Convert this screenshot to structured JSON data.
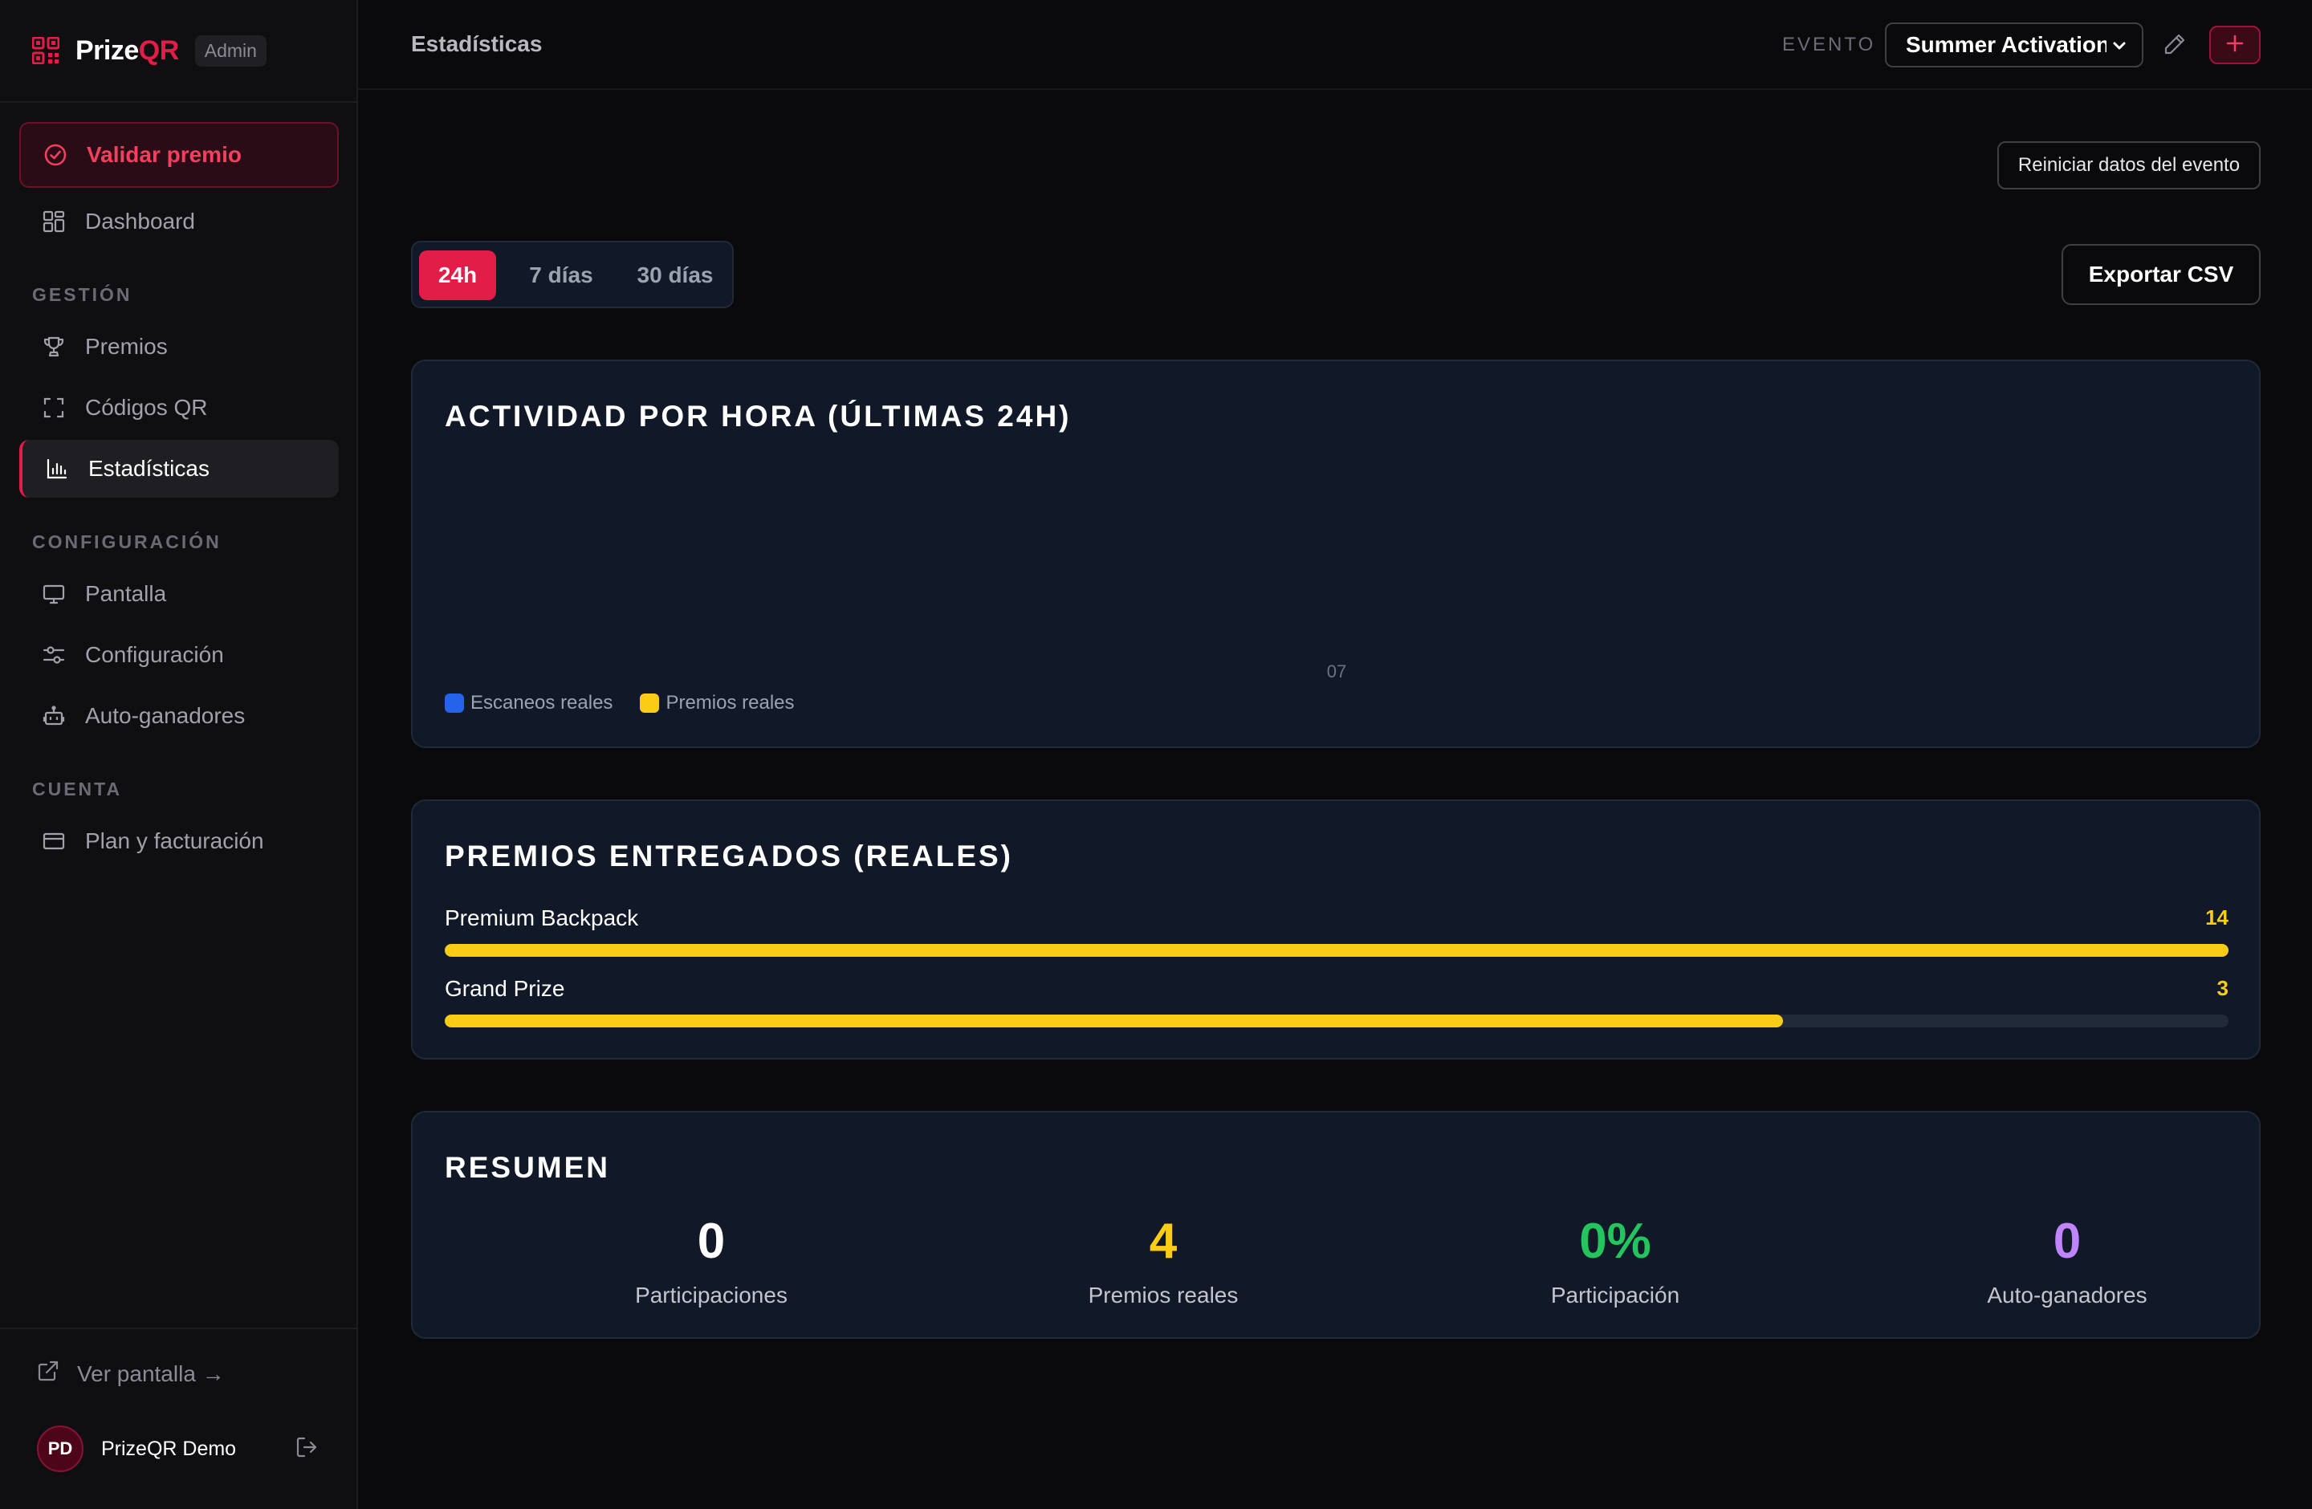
{
  "brand": {
    "name_part1": "Prize",
    "name_part2": "QR",
    "badge": "Admin"
  },
  "sidebar": {
    "primary_action": {
      "label": "Validar premio",
      "icon": "check-circle-icon"
    },
    "dashboard": {
      "label": "Dashboard",
      "icon": "grid-icon"
    },
    "sections": [
      {
        "label": "GESTIÓN",
        "items": [
          {
            "label": "Premios",
            "icon": "trophy-icon"
          },
          {
            "label": "Códigos QR",
            "icon": "scan-icon"
          },
          {
            "label": "Estadísticas",
            "icon": "bar-chart-icon",
            "active": true
          }
        ]
      },
      {
        "label": "CONFIGURACIÓN",
        "items": [
          {
            "label": "Pantalla",
            "icon": "monitor-icon"
          },
          {
            "label": "Configuración",
            "icon": "sliders-icon"
          },
          {
            "label": "Auto-ganadores",
            "icon": "robot-icon"
          }
        ]
      },
      {
        "label": "CUENTA",
        "items": [
          {
            "label": "Plan y facturación",
            "icon": "credit-card-icon"
          }
        ]
      }
    ],
    "footer": {
      "view_screen": "Ver pantalla →",
      "user_initials": "PD",
      "user_name": "PrizeQR Demo"
    }
  },
  "topbar": {
    "title": "Estadísticas",
    "event_label": "EVENTO",
    "event_selected": "Summer Activation"
  },
  "actions": {
    "reset": "Reiniciar datos del evento",
    "export": "Exportar CSV"
  },
  "ranges": [
    "24h",
    "7 días",
    "30 días"
  ],
  "activity_card": {
    "title": "ACTIVIDAD POR HORA (ÚLTIMAS 24H)"
  },
  "chart_data": {
    "type": "bar",
    "title": "ACTIVIDAD POR HORA (ÚLTIMAS 24H)",
    "categories": [
      "07"
    ],
    "series": [
      {
        "name": "Escaneos reales",
        "values": [
          0
        ],
        "color": "#2563eb"
      },
      {
        "name": "Premios reales",
        "values": [
          0
        ],
        "color": "#facc15"
      }
    ],
    "legend": "bottom-left"
  },
  "prizes_card": {
    "title": "PREMIOS ENTREGADOS (REALES)",
    "items": [
      {
        "name": "Premium Backpack",
        "count": "14",
        "fraction": 1.0
      },
      {
        "name": "Grand Prize",
        "count": "3",
        "fraction": 0.75
      }
    ]
  },
  "summary_card": {
    "title": "RESUMEN",
    "stats": [
      {
        "value": "0",
        "label": "Participaciones",
        "color": "#ffffff"
      },
      {
        "value": "4",
        "label": "Premios reales",
        "color": "#facc15"
      },
      {
        "value": "0%",
        "label": "Participación",
        "color": "#22c55e"
      },
      {
        "value": "0",
        "label": "Auto-ganadores",
        "color": "#c084fc"
      }
    ]
  },
  "colors": {
    "accent": "#e11d48",
    "prize_bar": "#facc15"
  }
}
